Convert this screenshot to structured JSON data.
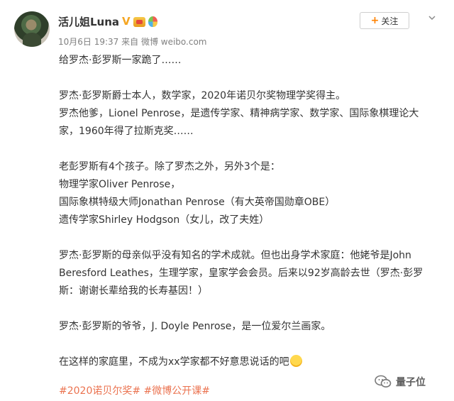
{
  "user": {
    "name": "活儿姐Luna",
    "verified_badge": "V",
    "badges": [
      "verified-icon",
      "crown-badge-icon",
      "balloon-badge-icon"
    ]
  },
  "meta": {
    "date": "10月6日 19:37",
    "source": "来自 微博 weibo.com"
  },
  "follow": {
    "plus": "+",
    "label": "关注"
  },
  "post": {
    "paragraphs": [
      [
        "给罗杰·彭罗斯一家跪了……"
      ],
      [
        "罗杰·彭罗斯爵士本人，数学家，2020年诺贝尔奖物理学奖得主。",
        "罗杰他爹，Lionel Penrose，是遗传学家、精神病学家、数学家、国际象棋理论大",
        "家，1960年得了拉斯克奖……"
      ],
      [
        "老彭罗斯有4个孩子。除了罗杰之外，另外3个是：",
        "物理学家Oliver Penrose，",
        "国际象棋特级大师Jonathan Penrose（有大英帝国勋章OBE）",
        "遗传学家Shirley Hodgson（女儿，改了夫姓）"
      ],
      [
        "罗杰·彭罗斯的母亲似乎没有知名的学术成就。但也出身学术家庭：他姥爷是John",
        "Beresford Leathes，生理学家，皇家学会会员。后来以92岁高龄去世（罗杰·彭罗",
        "斯：谢谢长辈给我的长寿基因！）"
      ],
      [
        "罗杰·彭罗斯的爷爷，J. Doyle Penrose，是一位爱尔兰画家。"
      ],
      [
        "在这样的家庭里，不成为xx学家都不好意思说话的吧"
      ]
    ]
  },
  "tags": "#2020诺贝尔奖# #微博公开课#",
  "watermark": "量子位",
  "colors": {
    "tag": "#eb7350",
    "follow_plus": "#ff8200",
    "meta": "#808080",
    "text": "#333333"
  }
}
